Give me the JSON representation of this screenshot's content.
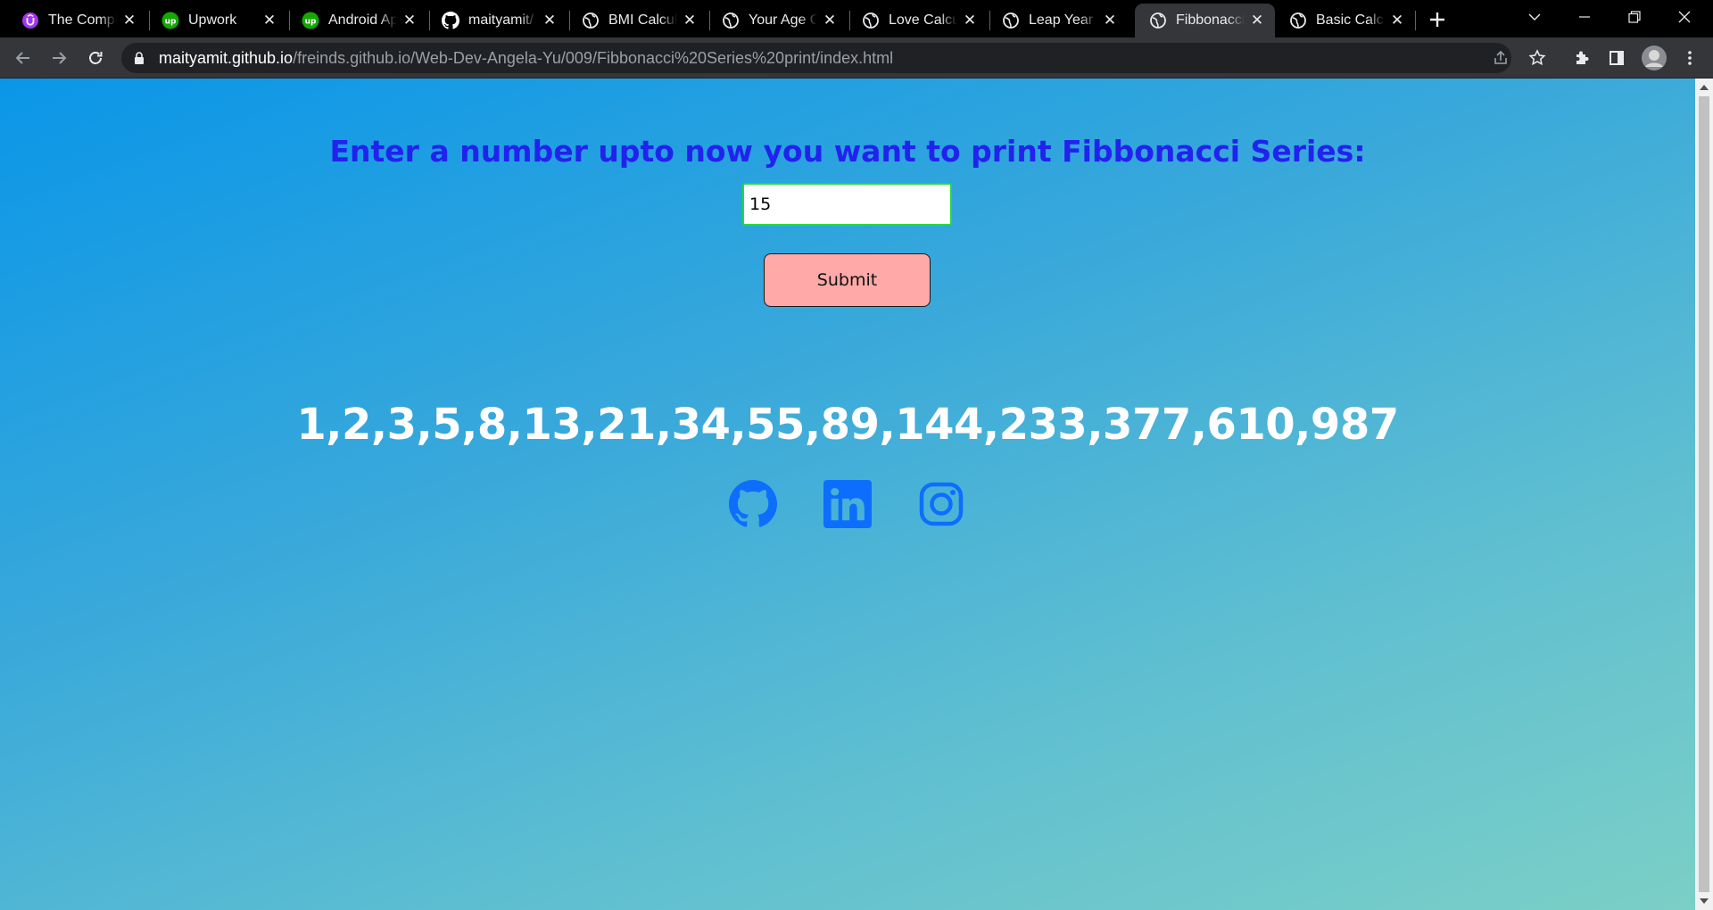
{
  "browser": {
    "tabs": [
      {
        "title": "The Comple",
        "icon": "udemy-icon",
        "active": false
      },
      {
        "title": "Upwork",
        "icon": "upwork-icon",
        "active": false
      },
      {
        "title": "Android Ap",
        "icon": "upwork-icon",
        "active": false
      },
      {
        "title": "maityamit/",
        "icon": "github-icon",
        "active": false
      },
      {
        "title": "BMI Calcula",
        "icon": "globe-icon",
        "active": false
      },
      {
        "title": "Your Age C",
        "icon": "globe-icon",
        "active": false
      },
      {
        "title": "Love Calcul",
        "icon": "globe-icon",
        "active": false
      },
      {
        "title": "Leap Year C",
        "icon": "globe-icon",
        "active": false
      },
      {
        "title": "Fibbonacci",
        "icon": "globe-icon",
        "active": true
      },
      {
        "title": "Basic Calcul",
        "icon": "globe-icon",
        "active": false
      }
    ],
    "url_host": "maityamit.github.io",
    "url_path": "/freinds.github.io/Web-Dev-Angela-Yu/009/Fibbonacci%20Series%20print/index.html"
  },
  "page": {
    "heading": "Enter a number upto now you want to print Fibbonacci Series:",
    "input_value": "15",
    "submit_label": "Submit",
    "result": "1,2,3,5,8,13,21,34,55,89,144,233,377,610,987",
    "social_icons": [
      "github-icon",
      "linkedin-icon",
      "instagram-icon"
    ],
    "social_color": "#0d6efd"
  },
  "colors": {
    "heading": "#2222ee",
    "button_bg": "#ffa9a9",
    "input_border": "#22dd33",
    "result_text": "#ffffff"
  }
}
